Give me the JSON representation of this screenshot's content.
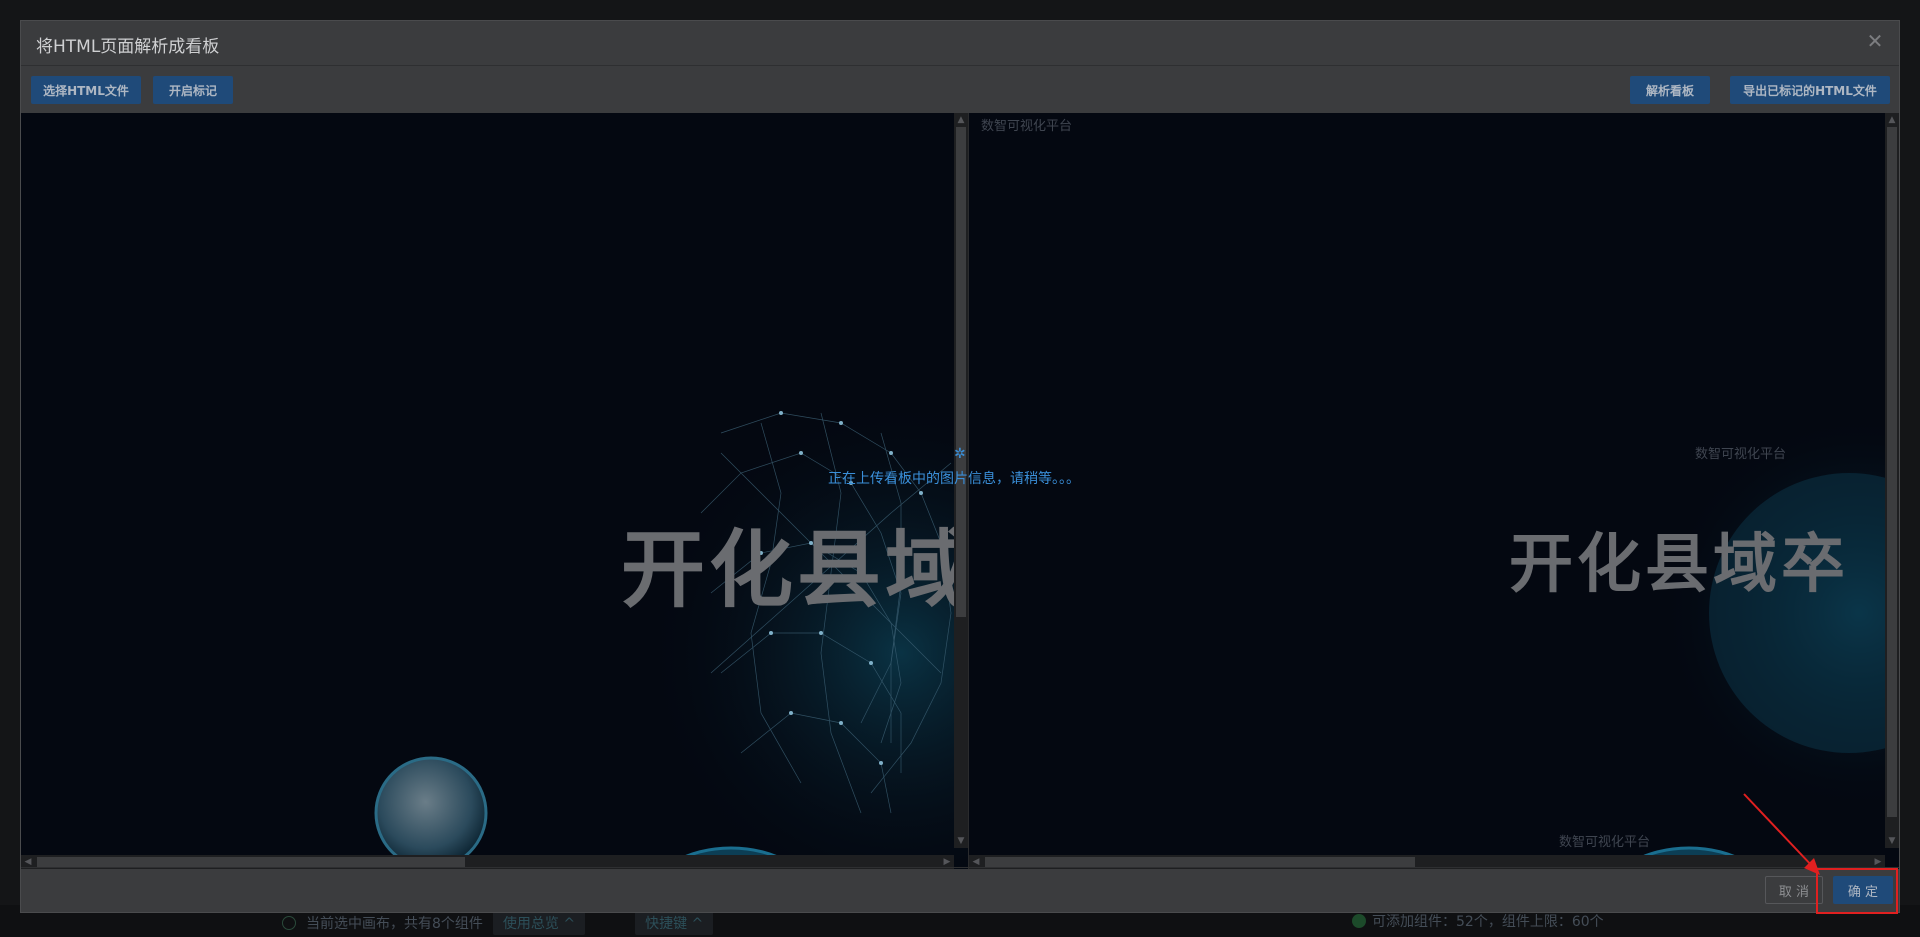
{
  "dialog": {
    "title": "将HTML页面解析成看板",
    "close_icon": "close-icon"
  },
  "toolbar": {
    "select_file": "选择HTML文件",
    "start_mark": "开启标记",
    "parse_board": "解析看板",
    "export_marked": "导出已标记的HTML文件"
  },
  "left_preview": {
    "big_title": "开化县域"
  },
  "right_preview": {
    "top_label": "数智可视化平台",
    "mid_label": "数智可视化平台",
    "big_title": "开化县域卒",
    "bottom_label": "数智可视化平台"
  },
  "loading": {
    "text": "正在上传看板中的图片信息，请稍等。。。"
  },
  "footer": {
    "cancel": "取 消",
    "ok": "确 定"
  },
  "background_status": {
    "canvas_info": "当前选中画布，共有8个组件",
    "use_overview": "使用总览 ^",
    "shortcuts": "快捷键 ^",
    "capacity": "可添加组件：52个，组件上限：60个"
  },
  "colors": {
    "accent_blue": "#3a8fd9",
    "button_blue": "#1f4a79",
    "highlight_red": "#e02020",
    "panel_bg": "#040811"
  }
}
